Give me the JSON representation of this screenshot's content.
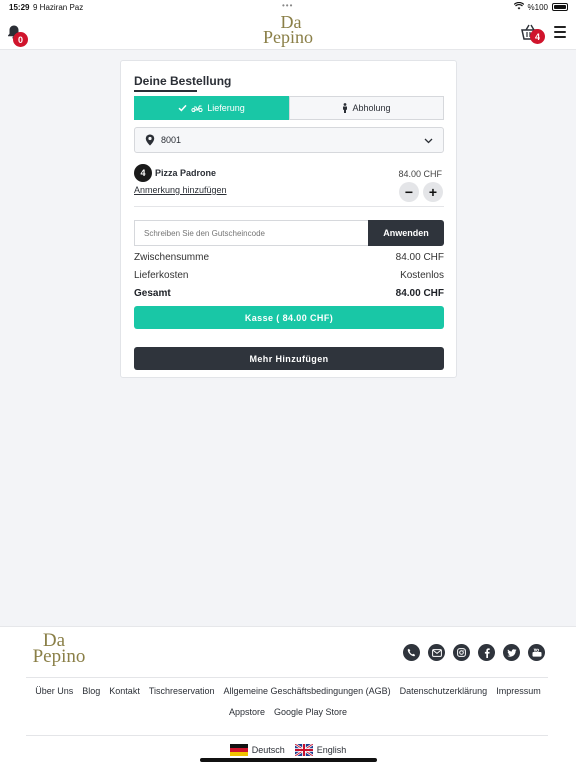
{
  "status_bar": {
    "time": "15:29",
    "date": "9 Haziran Paz",
    "battery": "%100"
  },
  "header": {
    "logo_line1": "Da",
    "logo_line2": "Pepino",
    "notifications_count": "0",
    "cart_count": "4"
  },
  "order": {
    "title": "Deine Bestellung",
    "delivery_label": "Lieferung",
    "pickup_label": "Abholung",
    "address_value": "8001",
    "item": {
      "qty": "4",
      "name": "Pizza Padrone",
      "price": "84.00 CHF",
      "note_link": "Anmerkung hinzufügen",
      "minus": "−",
      "plus": "+"
    },
    "coupon": {
      "placeholder": "Schreiben Sie den Gutscheincode",
      "apply_label": "Anwenden"
    },
    "summary": {
      "subtotal_label": "Zwischensumme",
      "subtotal_value": "84.00 CHF",
      "delivery_label": "Lieferkosten",
      "delivery_value": "Kostenlos",
      "total_label": "Gesamt",
      "total_value": "84.00 CHF"
    },
    "checkout_label": "Kasse ( 84.00 CHF)",
    "add_more_label": "Mehr Hinzufügen"
  },
  "footer": {
    "logo_line1": "Da",
    "logo_line2": "Pepino",
    "links_row1": [
      "Über Uns",
      "Blog",
      "Kontakt",
      "Tischreservation",
      "Allgemeine Geschäftsbedingungen (AGB)",
      "Datenschutzerklärung",
      "Impressum"
    ],
    "links_row2": [
      "Appstore",
      "Google Play Store"
    ],
    "lang_de": "Deutsch",
    "lang_en": "English",
    "social_icons": [
      "phone-icon",
      "mail-icon",
      "instagram-icon",
      "facebook-icon",
      "twitter-icon",
      "youtube-icon"
    ]
  },
  "colors": {
    "accent": "#19c7a6",
    "dark": "#2f343c",
    "badge": "#d0142c",
    "logo": "#8a7f47"
  }
}
